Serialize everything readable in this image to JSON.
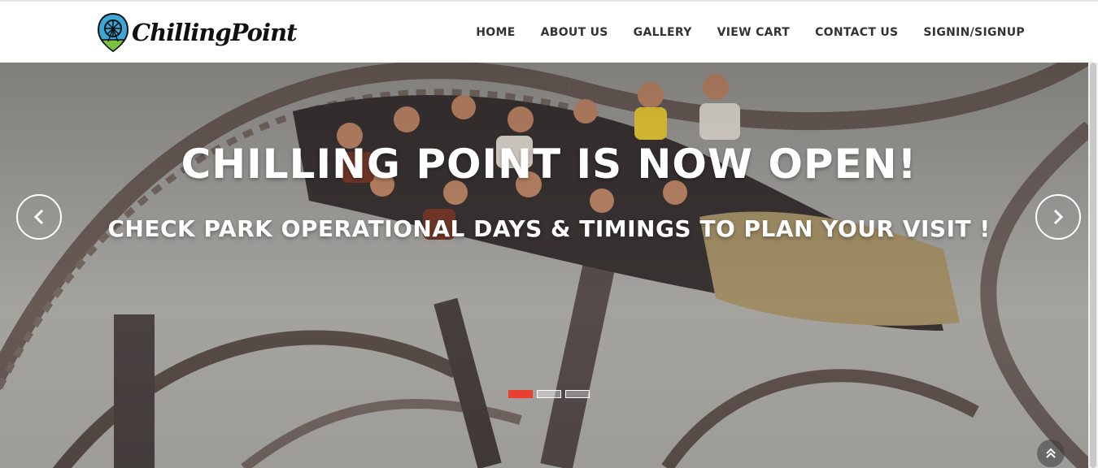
{
  "brand": {
    "name": "ChillingPoint",
    "logo_icon": "ferris-wheel-icon",
    "colors": {
      "logo_blue": "#3aa7d6",
      "logo_green": "#7cc242",
      "logo_text": "#111111"
    }
  },
  "nav": {
    "items": [
      {
        "label": "HOME"
      },
      {
        "label": "ABOUT US"
      },
      {
        "label": "GALLERY"
      },
      {
        "label": "VIEW CART"
      },
      {
        "label": "CONTACT US"
      },
      {
        "label": "SIGNIN/SIGNUP"
      }
    ]
  },
  "hero": {
    "title": "CHILLING POINT IS NOW OPEN!",
    "subtitle": "CHECK PARK OPERATIONAL DAYS & TIMINGS TO PLAN YOUR VISIT !",
    "prev_icon": "chevron-left-icon",
    "next_icon": "chevron-right-icon",
    "slides_total": 3,
    "active_slide": 1,
    "colors": {
      "active_indicator": "#e8402e",
      "text": "#ffffff"
    }
  },
  "back_to_top": {
    "icon": "double-chevron-up-icon"
  }
}
